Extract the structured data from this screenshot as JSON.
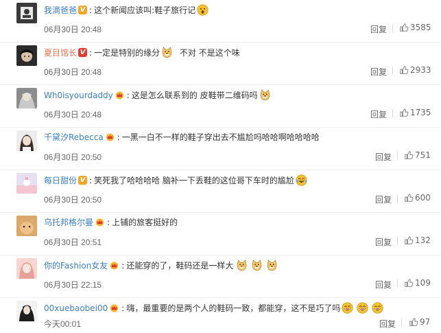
{
  "comments": [
    {
      "user": "我滴爸爸",
      "badge": "v-orange",
      "text": "这个新闻应该叫:鞋子旅行记",
      "extra": "",
      "emojis": [
        "surprised-emoji"
      ],
      "time": "06月30日 20:48",
      "reply": "回复",
      "likes": "3585"
    },
    {
      "user": "夏目馆长",
      "badge": "v-red",
      "text": "一定是特别的缘分",
      "extra": "不对 不是这个味",
      "emojis": [
        "doge-emoji"
      ],
      "time": "06月30日 20:48",
      "reply": "回复",
      "likes": "2933"
    },
    {
      "user": "Wh0isyourdaddy",
      "badge": "crown",
      "text": "这是怎么联系到的 皮鞋带二维码吗",
      "extra": "",
      "emojis": [
        "doge-emoji"
      ],
      "time": "06月30日 20:48",
      "reply": "回复",
      "likes": "1735"
    },
    {
      "user": "千黛汐Rebecca",
      "badge": "crown",
      "text": "一黑一白不一样的鞋子穿出去不尴尬吗哈哈啊哈哈哈哈",
      "extra": "",
      "emojis": [],
      "time": "06月30日 20:50",
      "reply": "回复",
      "likes": "751"
    },
    {
      "user": "每日甜份",
      "badge": "v-orange",
      "text": "笑死我了哈哈哈哈 脑补一下丢鞋的这位哥下车时的尴尬",
      "extra": "",
      "emojis": [
        "laughing-cry-emoji"
      ],
      "time": "06月30日 20:50",
      "reply": "回复",
      "likes": "600"
    },
    {
      "user": "乌托邦格尔曼",
      "badge": "crown",
      "text": "上铺的旅客挺好的",
      "extra": "",
      "emojis": [],
      "time": "06月30日 20:51",
      "reply": "回复",
      "likes": "132"
    },
    {
      "user": "你的Fashion女友",
      "badge": "crown",
      "text": "还能穿的了，鞋码还是一样大",
      "extra": "",
      "emojis": [
        "doge-emoji",
        "doge-emoji",
        "doge-emoji"
      ],
      "time": "06月30日 22:15",
      "reply": "回复",
      "likes": "109"
    },
    {
      "user": "00xuebaobei00",
      "badge": "crown",
      "text": "嗨，最重要的是两个人的鞋码一致，都能穿，这不是巧了吗",
      "extra": "",
      "emojis": [
        "grin-emoji",
        "grin-emoji",
        "grin-emoji"
      ],
      "time": "今天00:01",
      "reply": "回复",
      "likes": "97"
    }
  ],
  "colors": {
    "username": "#eb7350",
    "username_alt": "#3b7fc4",
    "text": "#333333",
    "meta": "#666666"
  }
}
